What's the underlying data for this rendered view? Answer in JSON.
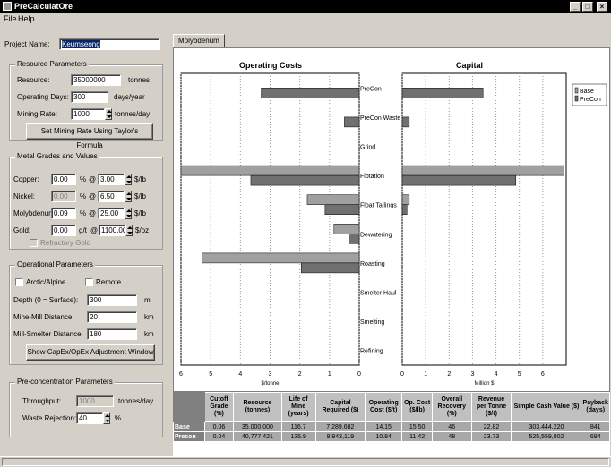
{
  "window": {
    "title": "PreCalculatOre"
  },
  "menu": {
    "file": "File",
    "help": "Help"
  },
  "project": {
    "label": "Project Name:",
    "value": "Keumseong"
  },
  "resource": {
    "group_title": "Resource Parameters",
    "resource_label": "Resource:",
    "resource_value": "35000000",
    "resource_unit": "tonnes",
    "opdays_label": "Operating Days:",
    "opdays_value": "300",
    "opdays_unit": "days/year",
    "rate_label": "Mining Rate:",
    "rate_value": "1000",
    "rate_unit": "tonnes/day",
    "taylor_button": "Set Mining Rate Using Taylor's Formula"
  },
  "metals": {
    "group_title": "Metal Grades and Values",
    "copper": {
      "label": "Copper:",
      "grade": "0.00",
      "unit": "%",
      "at": "@",
      "price": "3.00",
      "price_unit": "$/lb"
    },
    "nickel": {
      "label": "Nickel:",
      "grade": "0.00",
      "unit": "%",
      "at": "@",
      "price": "6.50",
      "price_unit": "$/lb"
    },
    "molybdenum": {
      "label": "Molybdenum:",
      "grade": "0.09",
      "unit": "%",
      "at": "@",
      "price": "25.00",
      "price_unit": "$/lb"
    },
    "gold": {
      "label": "Gold:",
      "grade": "0.00",
      "unit": "g/t",
      "at": "@",
      "price": "1100.00",
      "price_unit": "$/oz"
    },
    "refractory": "Refractory Gold"
  },
  "operational": {
    "group_title": "Operational Parameters",
    "arctic": "Arctic/Alpine",
    "remote": "Remote",
    "depth_label": "Depth (0 = Surface):",
    "depth_value": "300",
    "depth_unit": "m",
    "minemill_label": "Mine-Mill Distance:",
    "minemill_value": "20",
    "minemill_unit": "km",
    "millsmelter_label": "Mill-Smelter Distance:",
    "millsmelter_value": "180",
    "millsmelter_unit": "km",
    "capex_button": "Show CapEx/OpEx Adjustment Window"
  },
  "preconc": {
    "group_title": "Pre-concentration Parameters",
    "throughput_label": "Throughput:",
    "throughput_value": "1000",
    "throughput_unit": "tonnes/day",
    "waste_label": "Waste Rejection:",
    "waste_value": "40",
    "waste_unit": "%"
  },
  "tabs": {
    "active": "Molybdenum"
  },
  "colors": {
    "base": "#a0a0a0",
    "precon": "#707070"
  },
  "chart_data": [
    {
      "type": "bar",
      "orientation": "horizontal",
      "title": "Operating Costs",
      "xlabel": "$/tonne",
      "xlim": [
        0,
        6
      ],
      "x_reversed": true,
      "ticks": [
        "6",
        "5",
        "4",
        "3",
        "2",
        "1",
        "0"
      ],
      "categories": [
        "PreCon",
        "PreCon Waste",
        "Grind",
        "Flotation",
        "Float Tailings",
        "Dewatering",
        "Roasting",
        "Smelter Haul",
        "Smelting",
        "Refining"
      ],
      "series": [
        {
          "name": "Base",
          "values": [
            0,
            0,
            0,
            6.0,
            1.75,
            0.85,
            5.3,
            0,
            0,
            0
          ]
        },
        {
          "name": "PreCon",
          "values": [
            3.3,
            0.5,
            0,
            3.65,
            1.15,
            0.35,
            1.95,
            0,
            0,
            0
          ]
        }
      ]
    },
    {
      "type": "bar",
      "orientation": "horizontal",
      "title": "Capital",
      "xlabel": "Million $",
      "xlim": [
        0,
        7
      ],
      "ticks": [
        "0",
        "1",
        "2",
        "3",
        "4",
        "5",
        "6"
      ],
      "categories": [
        "PreCon",
        "PreCon Waste",
        "Grind",
        "Flotation",
        "Float Tailings",
        "Dewatering",
        "Roasting",
        "Smelter Haul",
        "Smelting",
        "Refining"
      ],
      "series": [
        {
          "name": "Base",
          "values": [
            0,
            0,
            0,
            6.9,
            0.3,
            0,
            0,
            0,
            0,
            0
          ]
        },
        {
          "name": "PreCon",
          "values": [
            3.45,
            0.3,
            0,
            4.85,
            0.2,
            0,
            0,
            0,
            0,
            0
          ]
        }
      ],
      "legend": "top-right"
    }
  ],
  "results": {
    "headers": [
      "Cutoff Grade (%)",
      "Resource (tonnes)",
      "Life of Mine (years)",
      "Capital Required ($)",
      "Operating Cost ($/t)",
      "Op. Cost ($/lb)",
      "Overall Recovery (%)",
      "Revenue per Tonne ($/t)",
      "Simple Cash Value ($)",
      "Payback (days)"
    ],
    "rows": [
      {
        "label": "Base",
        "cells": [
          "0.06",
          "35,000,000",
          "116.7",
          "7,289,682",
          "14.15",
          "15.50",
          "46",
          "22.82",
          "303,444,220",
          "841"
        ]
      },
      {
        "label": "Precon",
        "cells": [
          "0.04",
          "40,777,421",
          "135.9",
          "8,943,119",
          "10.84",
          "11.42",
          "48",
          "23.73",
          "525,559,802",
          "694"
        ]
      }
    ]
  }
}
